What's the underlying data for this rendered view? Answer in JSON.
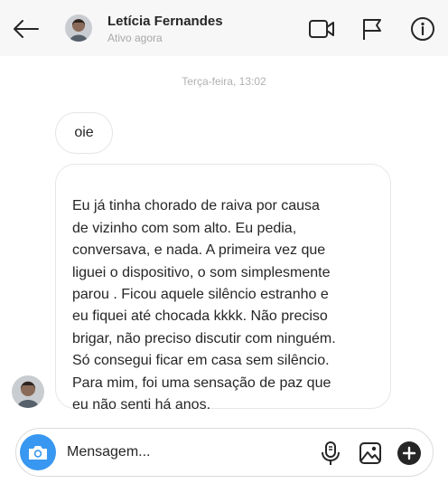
{
  "header": {
    "contact_name": "Letícia Fernandes",
    "status": "Ativo agora",
    "icons": [
      "back-arrow-icon",
      "video-camera-icon",
      "flag-icon",
      "info-icon"
    ]
  },
  "conversation": {
    "timestamp": "Terça-feira, 13:02",
    "messages": [
      {
        "text": "oie"
      },
      {
        "text": "Eu já tinha chorado de raiva por causa\nde vizinho com som alto. Eu pedia,\nconversava, e nada. A primeira vez que\nliguei o dispositivo, o som simplesmente\nparou . Ficou aquele silêncio estranho e\neu fiquei até chocada kkkk. Não preciso\nbrigar, não preciso discutir com ninguém.\nSó consegui ficar em casa sem silêncio.\nPara mim, foi uma sensação de paz que\neu não senti há anos."
      }
    ]
  },
  "composer": {
    "placeholder": "Mensagem...",
    "icons": [
      "camera-icon",
      "microphone-icon",
      "image-icon",
      "add-icon"
    ]
  },
  "colors": {
    "accent": "#3897f0",
    "header_bg": "#f7f7f7",
    "bubble_border": "#e6e6e6",
    "timestamp": "#b0b0b0"
  }
}
